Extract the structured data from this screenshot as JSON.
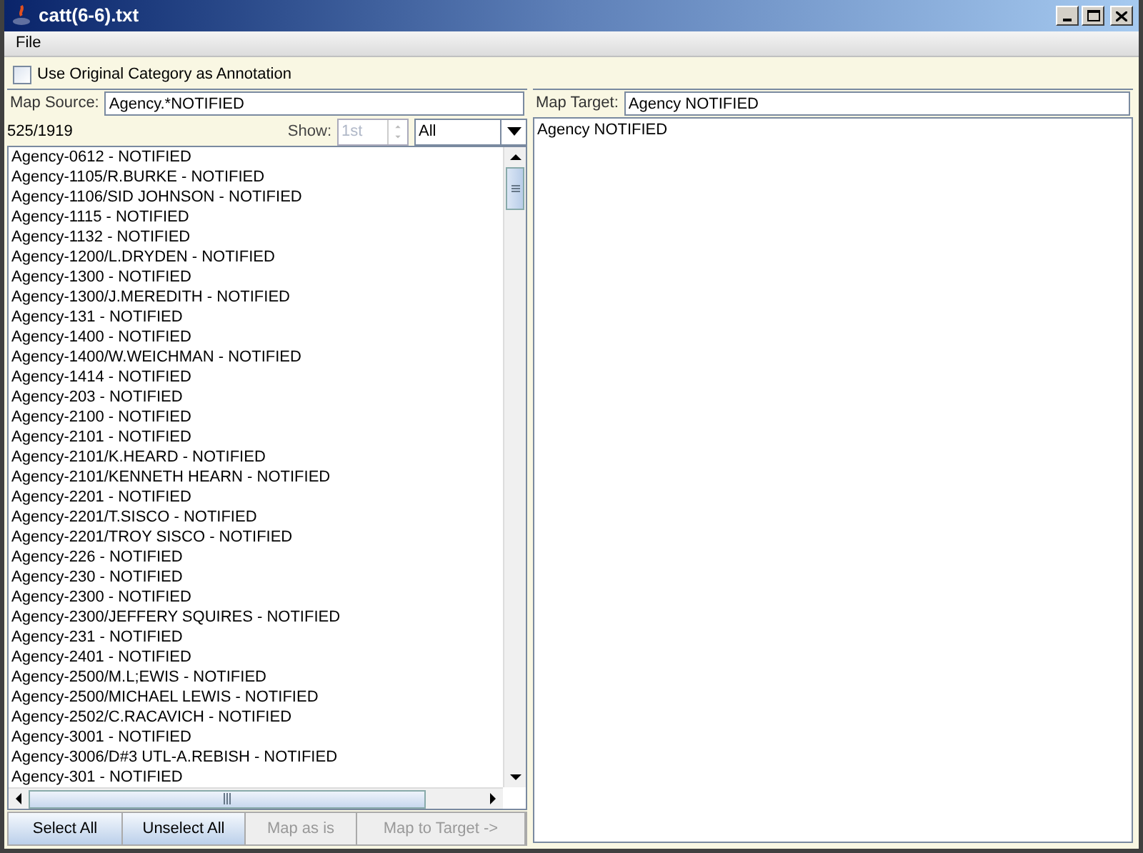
{
  "window": {
    "title": "catt(6-6).txt"
  },
  "menu": [
    "File"
  ],
  "option": {
    "label": "Use Original Category as Annotation",
    "checked": false
  },
  "source": {
    "label": "Map Source:",
    "value": "Agency.*NOTIFIED",
    "count": "525/1919",
    "show_label": "Show:",
    "show_value": "1st",
    "show_disabled": true,
    "filter": "All",
    "items": [
      "Agency-0612 - NOTIFIED",
      "Agency-1105/R.BURKE - NOTIFIED",
      "Agency-1106/SID JOHNSON - NOTIFIED",
      "Agency-1115 - NOTIFIED",
      "Agency-1132 - NOTIFIED",
      "Agency-1200/L.DRYDEN - NOTIFIED",
      "Agency-1300 - NOTIFIED",
      "Agency-1300/J.MEREDITH - NOTIFIED",
      "Agency-131 - NOTIFIED",
      "Agency-1400 - NOTIFIED",
      "Agency-1400/W.WEICHMAN - NOTIFIED",
      "Agency-1414 - NOTIFIED",
      "Agency-203 - NOTIFIED",
      "Agency-2100 - NOTIFIED",
      "Agency-2101 - NOTIFIED",
      "Agency-2101/K.HEARD - NOTIFIED",
      "Agency-2101/KENNETH HEARN - NOTIFIED",
      "Agency-2201 - NOTIFIED",
      "Agency-2201/T.SISCO - NOTIFIED",
      "Agency-2201/TROY SISCO - NOTIFIED",
      "Agency-226 - NOTIFIED",
      "Agency-230 - NOTIFIED",
      "Agency-2300 - NOTIFIED",
      "Agency-2300/JEFFERY SQUIRES - NOTIFIED",
      "Agency-231 - NOTIFIED",
      "Agency-2401 - NOTIFIED",
      "Agency-2500/M.L;EWIS - NOTIFIED",
      "Agency-2500/MICHAEL LEWIS - NOTIFIED",
      "Agency-2502/C.RACAVICH - NOTIFIED",
      "Agency-3001 - NOTIFIED",
      "Agency-3006/D#3 UTL-A.REBISH - NOTIFIED",
      "Agency-301 - NOTIFIED"
    ]
  },
  "buttons": [
    {
      "label": "Select All",
      "disabled": false
    },
    {
      "label": "Unselect All",
      "disabled": false
    },
    {
      "label": "Map as is",
      "disabled": true
    },
    {
      "label": "Map to Target ->",
      "disabled": true
    }
  ],
  "target": {
    "label": "Map Target:",
    "value": "Agency NOTIFIED",
    "items": [
      "Agency NOTIFIED"
    ]
  }
}
